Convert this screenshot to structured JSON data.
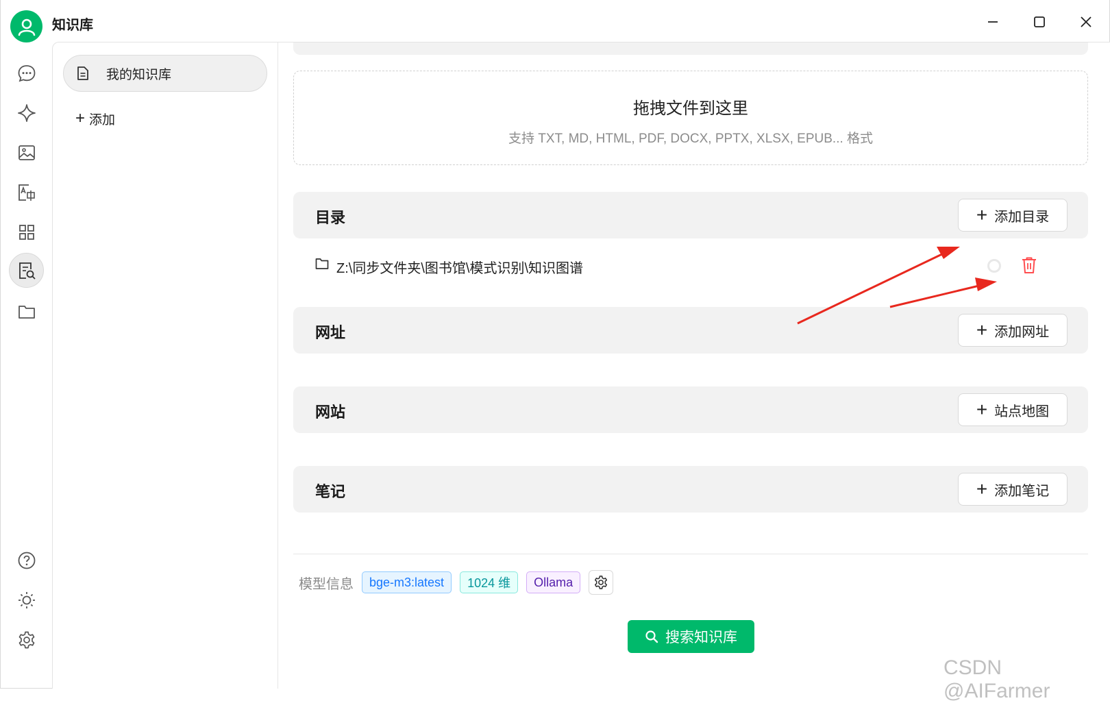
{
  "app": {
    "title": "知识库"
  },
  "window_controls": [
    "minimize-icon",
    "maximize-icon",
    "close-icon"
  ],
  "rail": {
    "items": [
      "chat-icon",
      "sparkle-icon",
      "image-icon",
      "translate-icon",
      "apps-icon",
      "knowledge-icon",
      "folder-icon"
    ],
    "bottom": [
      "help-icon",
      "sun-icon",
      "settings-icon"
    ],
    "active": "knowledge-icon"
  },
  "kb_sidebar": {
    "items": [
      {
        "label": "我的知识库"
      }
    ],
    "add_label": "添加"
  },
  "dropzone": {
    "title": "拖拽文件到这里",
    "subtitle": "支持 TXT, MD, HTML, PDF, DOCX, PPTX, XLSX, EPUB... 格式"
  },
  "sections": {
    "directory": {
      "title": "目录",
      "button": "添加目录"
    },
    "url": {
      "title": "网址",
      "button": "添加网址"
    },
    "website": {
      "title": "网站",
      "button": "站点地图"
    },
    "notes": {
      "title": "笔记",
      "button": "添加笔记"
    }
  },
  "directory_items": [
    {
      "path": "Z:\\同步文件夹\\图书馆\\模式识别\\知识图谱"
    }
  ],
  "model_info": {
    "label": "模型信息",
    "tags": [
      "bge-m3:latest",
      "1024 维",
      "Ollama"
    ]
  },
  "search_button": "搜索知识库",
  "watermark": "CSDN @AIFarmer",
  "colors": {
    "accent": "#00b96b",
    "danger": "#ff4d4f",
    "annotation": "#e8281e"
  }
}
